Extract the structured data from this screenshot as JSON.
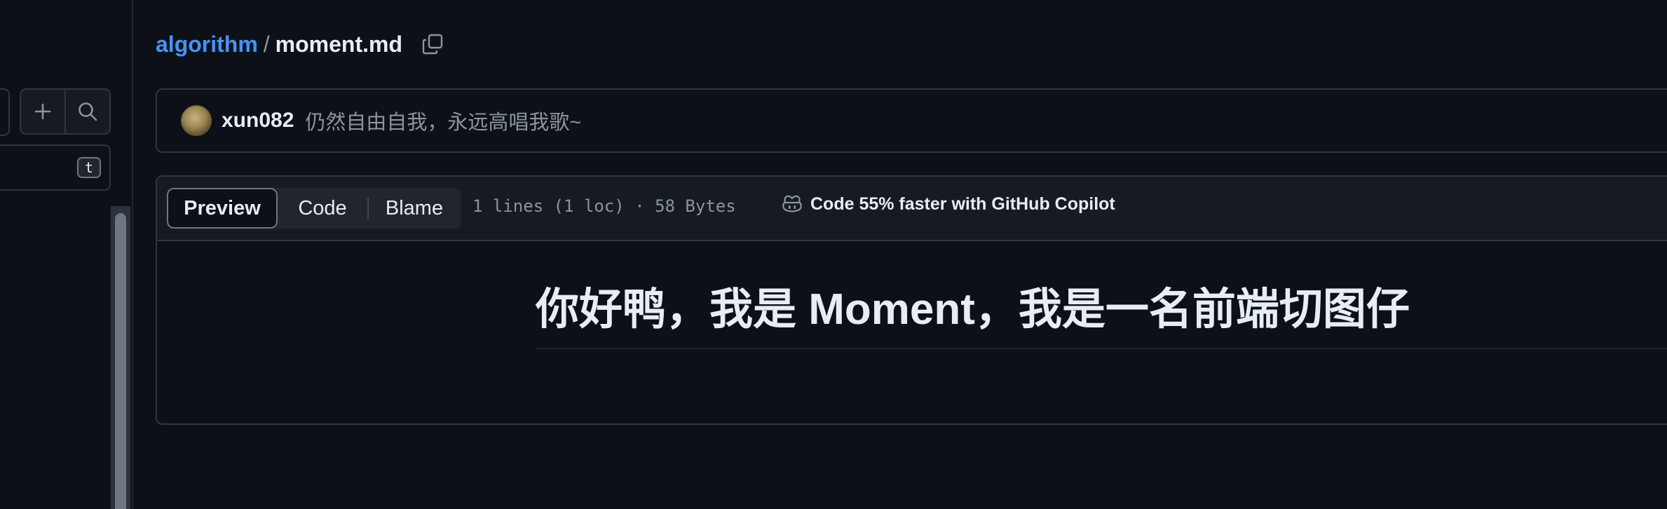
{
  "sidebar": {
    "add_icon": "plus-icon",
    "search_icon": "search-icon",
    "filter_shortcut": "t"
  },
  "breadcrumb": {
    "repo": "algorithm",
    "separator": "/",
    "file": "moment.md",
    "copy_icon": "copy-icon"
  },
  "commit": {
    "author": "xun082",
    "message": "仍然自由自我，永远高唱我歌~"
  },
  "file": {
    "tabs": [
      {
        "label": "Preview",
        "active": true
      },
      {
        "label": "Code",
        "active": false
      },
      {
        "label": "Blame",
        "active": false
      }
    ],
    "info": "1 lines (1 loc) · 58 Bytes",
    "copilot_icon": "copilot-icon",
    "copilot_text": "Code 55% faster with GitHub Copilot"
  },
  "content": {
    "heading": "你好鸭，我是 Moment，我是一名前端切图仔"
  },
  "colors": {
    "background": "#0d1117",
    "link": "#4493f8",
    "border": "#30363d",
    "muted": "#8b949e"
  }
}
